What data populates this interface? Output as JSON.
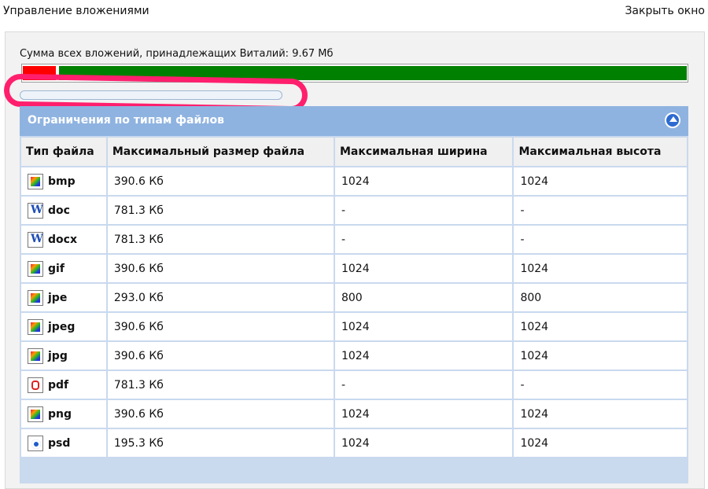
{
  "header": {
    "title": "Управление вложениями",
    "close_label": "Закрыть окно"
  },
  "usage": {
    "label": "Сумма всех вложений, принадлежащих Виталий: 9.67 Мб",
    "used_fraction": 0.05,
    "colors": {
      "used": "#ff0000",
      "free": "#008000"
    }
  },
  "section": {
    "title": "Ограничения по типам файлов",
    "columns": [
      "Тип файла",
      "Максимальный размер файла",
      "Максимальная ширина",
      "Максимальная высота"
    ],
    "rows": [
      {
        "icon": "image-file-icon",
        "ext": "bmp",
        "size": "390.6 Кб",
        "width": "1024",
        "height": "1024"
      },
      {
        "icon": "word-file-icon",
        "ext": "doc",
        "size": "781.3 Кб",
        "width": "-",
        "height": "-"
      },
      {
        "icon": "word-file-icon",
        "ext": "docx",
        "size": "781.3 Кб",
        "width": "-",
        "height": "-"
      },
      {
        "icon": "image-file-icon",
        "ext": "gif",
        "size": "390.6 Кб",
        "width": "1024",
        "height": "1024"
      },
      {
        "icon": "image-file-icon",
        "ext": "jpe",
        "size": "293.0 Кб",
        "width": "800",
        "height": "800"
      },
      {
        "icon": "image-file-icon",
        "ext": "jpeg",
        "size": "390.6 Кб",
        "width": "1024",
        "height": "1024"
      },
      {
        "icon": "image-file-icon",
        "ext": "jpg",
        "size": "390.6 Кб",
        "width": "1024",
        "height": "1024"
      },
      {
        "icon": "pdf-file-icon",
        "ext": "pdf",
        "size": "781.3 Кб",
        "width": "-",
        "height": "-"
      },
      {
        "icon": "image-file-icon",
        "ext": "png",
        "size": "390.6 Кб",
        "width": "1024",
        "height": "1024"
      },
      {
        "icon": "psd-file-icon",
        "ext": "psd",
        "size": "195.3 Кб",
        "width": "1024",
        "height": "1024"
      }
    ]
  }
}
